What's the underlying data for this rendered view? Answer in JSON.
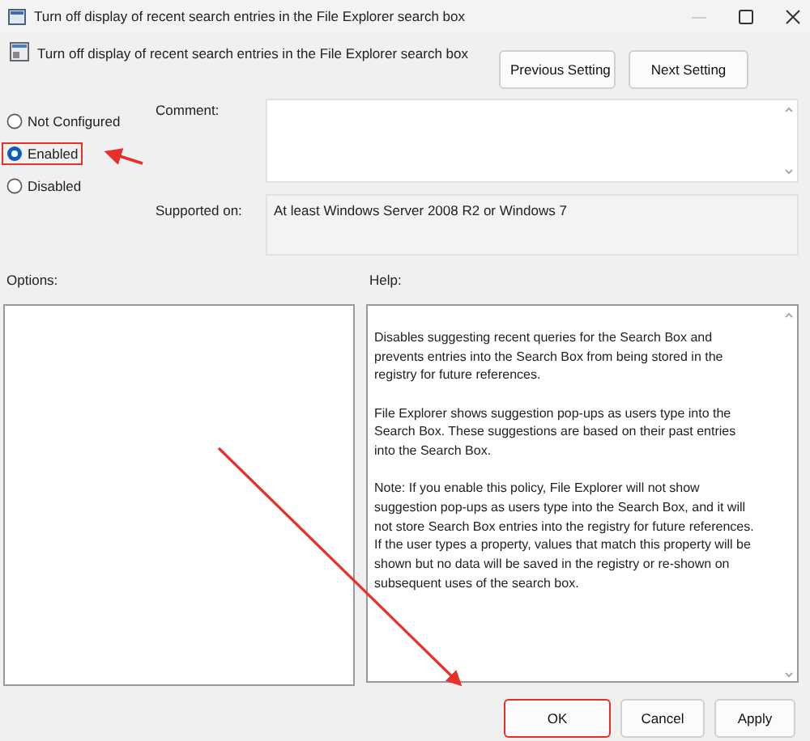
{
  "window": {
    "title": "Turn off display of recent search entries in the File Explorer search box"
  },
  "header": {
    "title": "Turn off display of recent search entries in the File Explorer search box",
    "buttons": [
      {
        "label": "Previous Setting"
      },
      {
        "label": "Next Setting"
      }
    ]
  },
  "state_options": [
    {
      "label": "Not Configured",
      "selected": false,
      "highlighted": false
    },
    {
      "label": "Enabled",
      "selected": true,
      "highlighted": true
    },
    {
      "label": "Disabled",
      "selected": false,
      "highlighted": false
    }
  ],
  "comment": {
    "label": "Comment:"
  },
  "supported_on": {
    "label": "Supported on:",
    "value": "At least Windows Server 2008 R2 or Windows 7"
  },
  "options": {
    "label": "Options:"
  },
  "help": {
    "label": "Help:",
    "paragraphs": [
      "Disables suggesting recent queries for the Search Box and prevents entries into the Search Box from being stored in the registry for future references.",
      "File Explorer shows suggestion pop-ups as users type into the Search Box.  These suggestions are based on their past entries into the Search Box.",
      "Note: If you enable this policy, File Explorer will not show suggestion pop-ups as users type into the Search Box, and it will not store Search Box entries into the registry for future references.  If the user types a property, values that match this property will be shown but no data will be saved in the registry or re-shown on subsequent uses of the search box."
    ]
  },
  "buttons": [
    {
      "label": "OK",
      "highlighted": true
    },
    {
      "label": "Cancel",
      "highlighted": false
    },
    {
      "label": "Apply",
      "highlighted": false
    }
  ]
}
